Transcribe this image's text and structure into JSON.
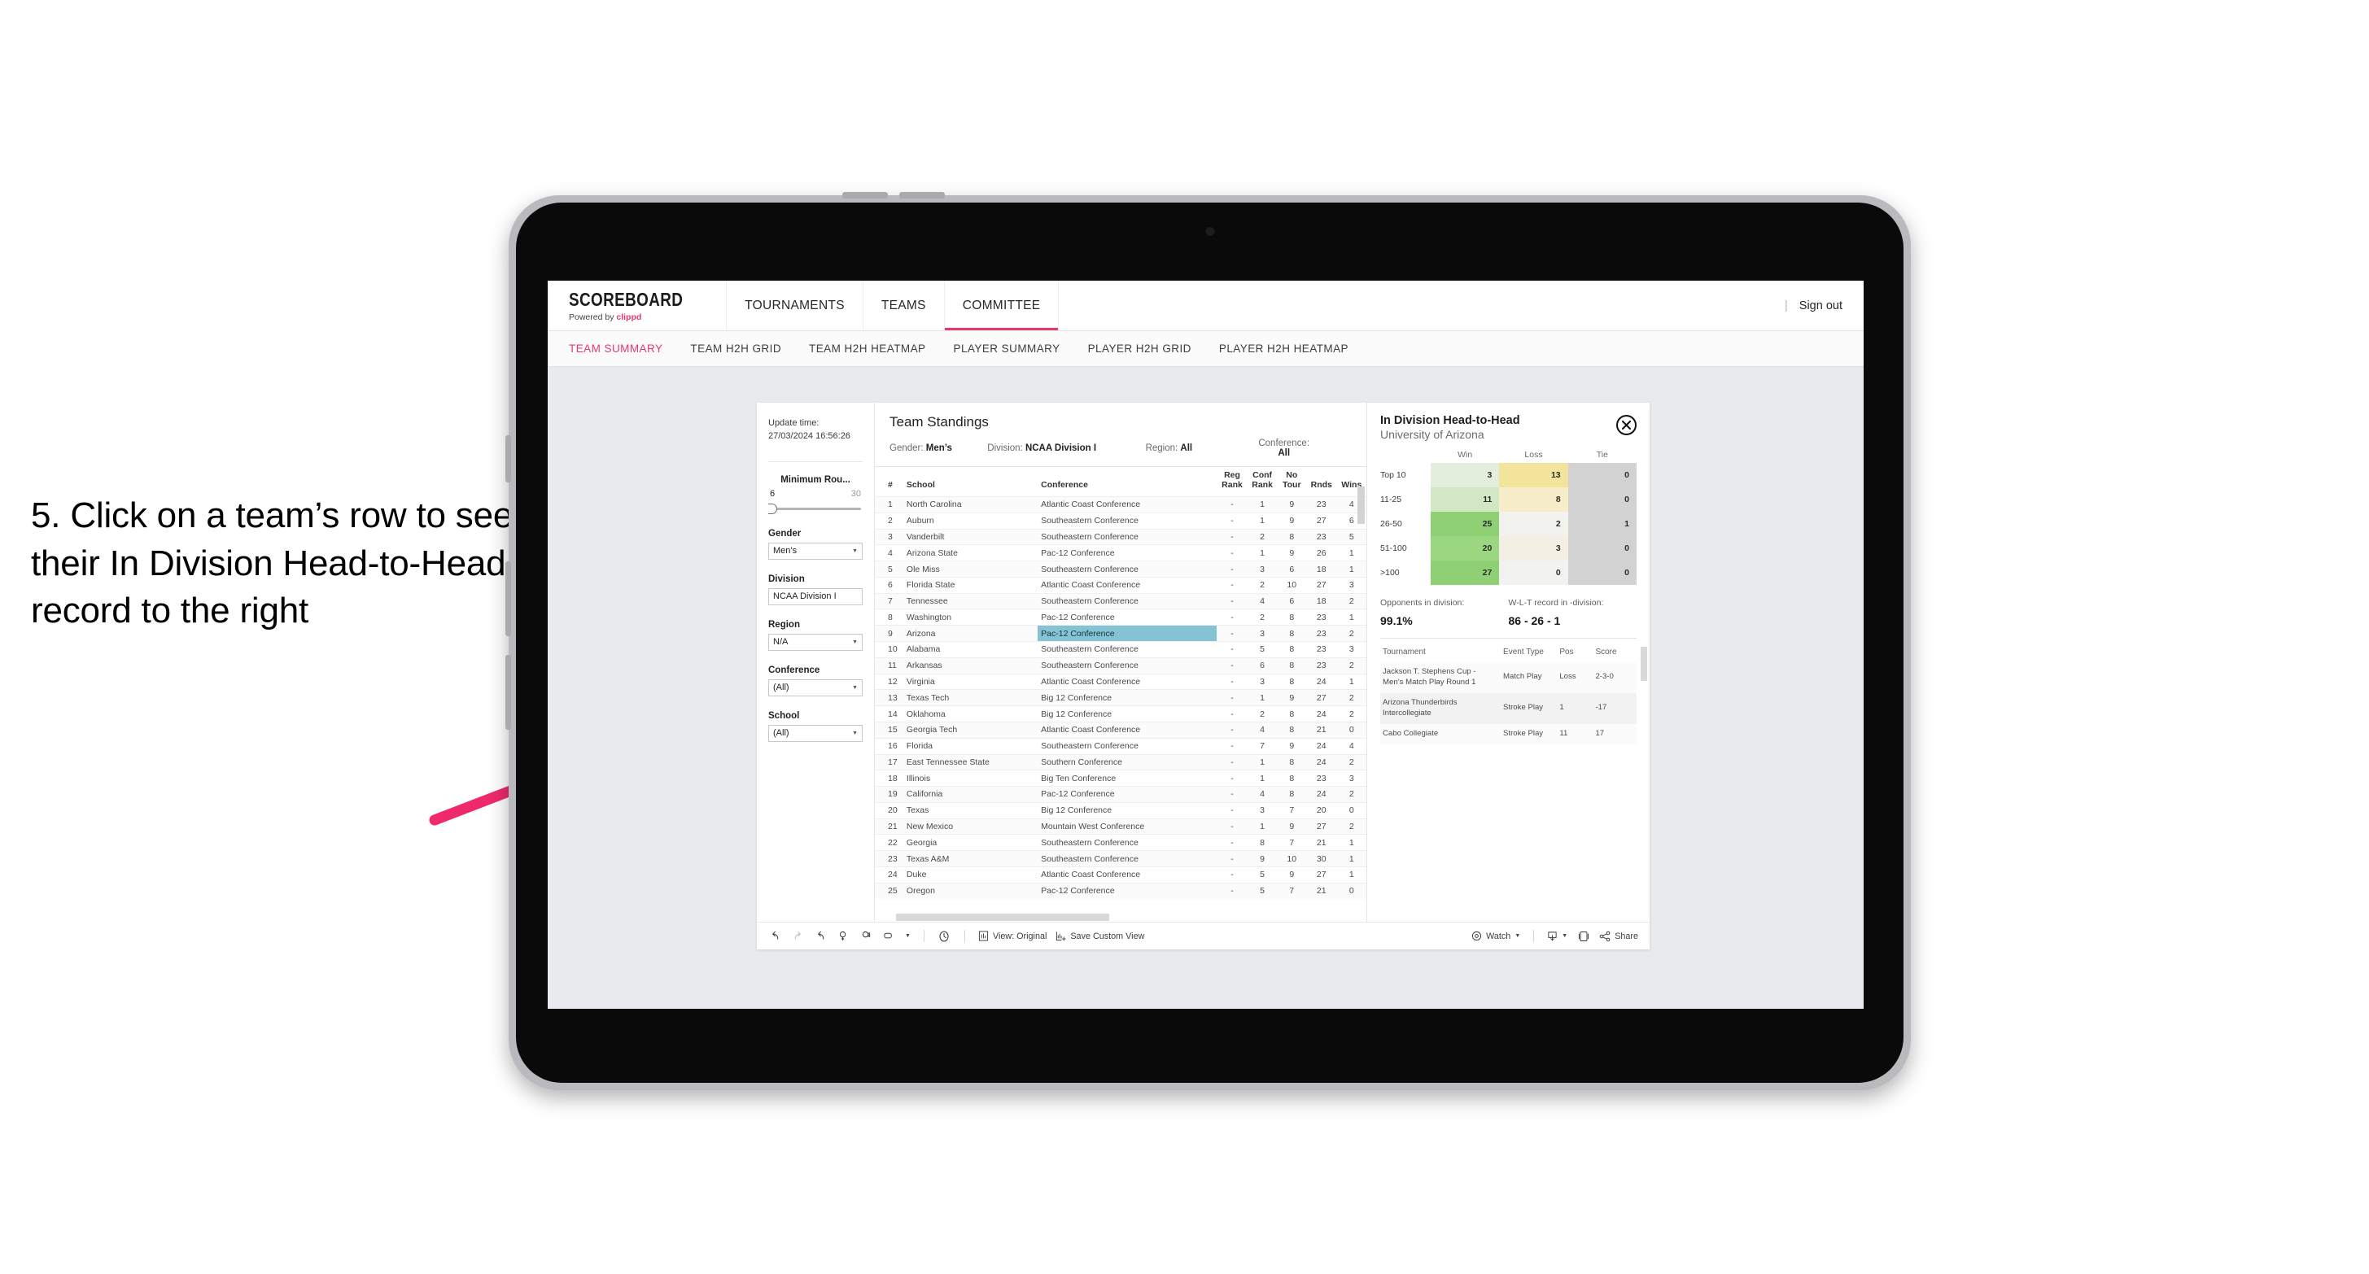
{
  "instruction": "5. Click on a team’s row to see their In Division Head-to-Head record to the right",
  "brand": {
    "title": "SCOREBOARD",
    "powered_prefix": "Powered by ",
    "powered_name": "clippd"
  },
  "topnav": {
    "tabs": [
      {
        "label": "TOURNAMENTS",
        "active": false
      },
      {
        "label": "TEAMS",
        "active": false
      },
      {
        "label": "COMMITTEE",
        "active": true
      }
    ],
    "separator": "|",
    "signout": "Sign out"
  },
  "subtabs": [
    {
      "label": "TEAM SUMMARY",
      "active": true
    },
    {
      "label": "TEAM H2H GRID",
      "active": false
    },
    {
      "label": "TEAM H2H HEATMAP",
      "active": false
    },
    {
      "label": "PLAYER SUMMARY",
      "active": false
    },
    {
      "label": "PLAYER H2H GRID",
      "active": false
    },
    {
      "label": "PLAYER H2H HEATMAP",
      "active": false
    }
  ],
  "filters": {
    "update_label": "Update time:",
    "update_value": "27/03/2024 16:56:26",
    "slider": {
      "title": "Minimum Rou...",
      "min": "6",
      "max": "30"
    },
    "gender": {
      "label": "Gender",
      "value": "Men’s"
    },
    "division": {
      "label": "Division",
      "value": "NCAA Division I"
    },
    "region": {
      "label": "Region",
      "value": "N/A"
    },
    "conference": {
      "label": "Conference",
      "value": "(All)"
    },
    "school": {
      "label": "School",
      "value": "(All)"
    }
  },
  "standings": {
    "title": "Team Standings",
    "meta": {
      "gender_k": "Gender: ",
      "gender_v": "Men’s",
      "division_k": "Division: ",
      "division_v": "NCAA Division I",
      "region_k": "Region: ",
      "region_v": "All",
      "conference_k": "Conference: ",
      "conference_v": "All"
    },
    "columns": [
      "#",
      "School",
      "Conference",
      "Reg Rank",
      "Conf Rank",
      "No Tour",
      "Rnds",
      "Wins"
    ],
    "rows": [
      {
        "rank": "1",
        "school": "North Carolina",
        "conf": "Atlantic Coast Conference",
        "reg": "-",
        "confrank": "1",
        "notour": "9",
        "rnds": "23",
        "wins": "4",
        "hl": false
      },
      {
        "rank": "2",
        "school": "Auburn",
        "conf": "Southeastern Conference",
        "reg": "-",
        "confrank": "1",
        "notour": "9",
        "rnds": "27",
        "wins": "6",
        "hl": false
      },
      {
        "rank": "3",
        "school": "Vanderbilt",
        "conf": "Southeastern Conference",
        "reg": "-",
        "confrank": "2",
        "notour": "8",
        "rnds": "23",
        "wins": "5",
        "hl": false
      },
      {
        "rank": "4",
        "school": "Arizona State",
        "conf": "Pac-12 Conference",
        "reg": "-",
        "confrank": "1",
        "notour": "9",
        "rnds": "26",
        "wins": "1",
        "hl": false
      },
      {
        "rank": "5",
        "school": "Ole Miss",
        "conf": "Southeastern Conference",
        "reg": "-",
        "confrank": "3",
        "notour": "6",
        "rnds": "18",
        "wins": "1",
        "hl": false
      },
      {
        "rank": "6",
        "school": "Florida State",
        "conf": "Atlantic Coast Conference",
        "reg": "-",
        "confrank": "2",
        "notour": "10",
        "rnds": "27",
        "wins": "3",
        "hl": false
      },
      {
        "rank": "7",
        "school": "Tennessee",
        "conf": "Southeastern Conference",
        "reg": "-",
        "confrank": "4",
        "notour": "6",
        "rnds": "18",
        "wins": "2",
        "hl": false
      },
      {
        "rank": "8",
        "school": "Washington",
        "conf": "Pac-12 Conference",
        "reg": "-",
        "confrank": "2",
        "notour": "8",
        "rnds": "23",
        "wins": "1",
        "hl": false
      },
      {
        "rank": "9",
        "school": "Arizona",
        "conf": "Pac-12 Conference",
        "reg": "-",
        "confrank": "3",
        "notour": "8",
        "rnds": "23",
        "wins": "2",
        "hl": true
      },
      {
        "rank": "10",
        "school": "Alabama",
        "conf": "Southeastern Conference",
        "reg": "-",
        "confrank": "5",
        "notour": "8",
        "rnds": "23",
        "wins": "3",
        "hl": false
      },
      {
        "rank": "11",
        "school": "Arkansas",
        "conf": "Southeastern Conference",
        "reg": "-",
        "confrank": "6",
        "notour": "8",
        "rnds": "23",
        "wins": "2",
        "hl": false
      },
      {
        "rank": "12",
        "school": "Virginia",
        "conf": "Atlantic Coast Conference",
        "reg": "-",
        "confrank": "3",
        "notour": "8",
        "rnds": "24",
        "wins": "1",
        "hl": false
      },
      {
        "rank": "13",
        "school": "Texas Tech",
        "conf": "Big 12 Conference",
        "reg": "-",
        "confrank": "1",
        "notour": "9",
        "rnds": "27",
        "wins": "2",
        "hl": false
      },
      {
        "rank": "14",
        "school": "Oklahoma",
        "conf": "Big 12 Conference",
        "reg": "-",
        "confrank": "2",
        "notour": "8",
        "rnds": "24",
        "wins": "2",
        "hl": false
      },
      {
        "rank": "15",
        "school": "Georgia Tech",
        "conf": "Atlantic Coast Conference",
        "reg": "-",
        "confrank": "4",
        "notour": "8",
        "rnds": "21",
        "wins": "0",
        "hl": false
      },
      {
        "rank": "16",
        "school": "Florida",
        "conf": "Southeastern Conference",
        "reg": "-",
        "confrank": "7",
        "notour": "9",
        "rnds": "24",
        "wins": "4",
        "hl": false
      },
      {
        "rank": "17",
        "school": "East Tennessee State",
        "conf": "Southern Conference",
        "reg": "-",
        "confrank": "1",
        "notour": "8",
        "rnds": "24",
        "wins": "2",
        "hl": false
      },
      {
        "rank": "18",
        "school": "Illinois",
        "conf": "Big Ten Conference",
        "reg": "-",
        "confrank": "1",
        "notour": "8",
        "rnds": "23",
        "wins": "3",
        "hl": false
      },
      {
        "rank": "19",
        "school": "California",
        "conf": "Pac-12 Conference",
        "reg": "-",
        "confrank": "4",
        "notour": "8",
        "rnds": "24",
        "wins": "2",
        "hl": false
      },
      {
        "rank": "20",
        "school": "Texas",
        "conf": "Big 12 Conference",
        "reg": "-",
        "confrank": "3",
        "notour": "7",
        "rnds": "20",
        "wins": "0",
        "hl": false
      },
      {
        "rank": "21",
        "school": "New Mexico",
        "conf": "Mountain West Conference",
        "reg": "-",
        "confrank": "1",
        "notour": "9",
        "rnds": "27",
        "wins": "2",
        "hl": false
      },
      {
        "rank": "22",
        "school": "Georgia",
        "conf": "Southeastern Conference",
        "reg": "-",
        "confrank": "8",
        "notour": "7",
        "rnds": "21",
        "wins": "1",
        "hl": false
      },
      {
        "rank": "23",
        "school": "Texas A&M",
        "conf": "Southeastern Conference",
        "reg": "-",
        "confrank": "9",
        "notour": "10",
        "rnds": "30",
        "wins": "1",
        "hl": false
      },
      {
        "rank": "24",
        "school": "Duke",
        "conf": "Atlantic Coast Conference",
        "reg": "-",
        "confrank": "5",
        "notour": "9",
        "rnds": "27",
        "wins": "1",
        "hl": false
      },
      {
        "rank": "25",
        "school": "Oregon",
        "conf": "Pac-12 Conference",
        "reg": "-",
        "confrank": "5",
        "notour": "7",
        "rnds": "21",
        "wins": "0",
        "hl": false
      }
    ]
  },
  "h2h": {
    "title": "In Division Head-to-Head",
    "subtitle": "University of Arizona",
    "close_icon": "close-icon",
    "matrix_headers": [
      "Win",
      "Loss",
      "Tie"
    ],
    "matrix_rows": [
      {
        "label": "Top 10",
        "win": "3",
        "loss": "13",
        "tie": "0",
        "win_bg": "#e3eedd",
        "loss_bg": "#f2e49b",
        "tie_bg": "#d2d2d2"
      },
      {
        "label": "11-25",
        "win": "11",
        "loss": "8",
        "tie": "0",
        "win_bg": "#d2e8c4",
        "loss_bg": "#f7eec9",
        "tie_bg": "#d2d2d2"
      },
      {
        "label": "26-50",
        "win": "25",
        "loss": "2",
        "tie": "1",
        "win_bg": "#8ed073",
        "loss_bg": "#f2f2ee",
        "tie_bg": "#d2d2d2"
      },
      {
        "label": "51-100",
        "win": "20",
        "loss": "3",
        "tie": "0",
        "win_bg": "#9bd681",
        "loss_bg": "#f3efe4",
        "tie_bg": "#d2d2d2"
      },
      {
        "label": ">100",
        "win": "27",
        "loss": "0",
        "tie": "0",
        "win_bg": "#8ed073",
        "loss_bg": "#f2f2f0",
        "tie_bg": "#d2d2d2"
      }
    ],
    "stat_opponents_k": "Opponents in division:",
    "stat_opponents_v": "99.1%",
    "stat_record_k": "W-L-T record in -division:",
    "stat_record_v": "86 - 26 - 1",
    "tour_columns": [
      "Tournament",
      "Event Type",
      "Pos",
      "Score"
    ],
    "tour_rows": [
      {
        "tournament": "Jackson T. Stephens Cup - Men’s Match Play Round 1",
        "event": "Match Play",
        "pos": "Loss",
        "score": "2-3-0"
      },
      {
        "tournament": "Arizona Thunderbirds Intercollegiate",
        "event": "Stroke Play",
        "pos": "1",
        "score": "-17"
      },
      {
        "tournament": "Cabo Collegiate",
        "event": "Stroke Play",
        "pos": "11",
        "score": "17"
      }
    ]
  },
  "toolbar": {
    "icons": [
      "undo-icon",
      "redo-icon",
      "revert-icon",
      "refresh-icon",
      "pause-icon",
      "export-icon"
    ],
    "view_label": "View: Original",
    "save_label": "Save Custom View",
    "watch_label": "Watch",
    "share_label": "Share"
  },
  "colors": {
    "accent": "#e8386b",
    "highlight_row": "#85c3d4",
    "arrow": "#ee2a6c"
  }
}
